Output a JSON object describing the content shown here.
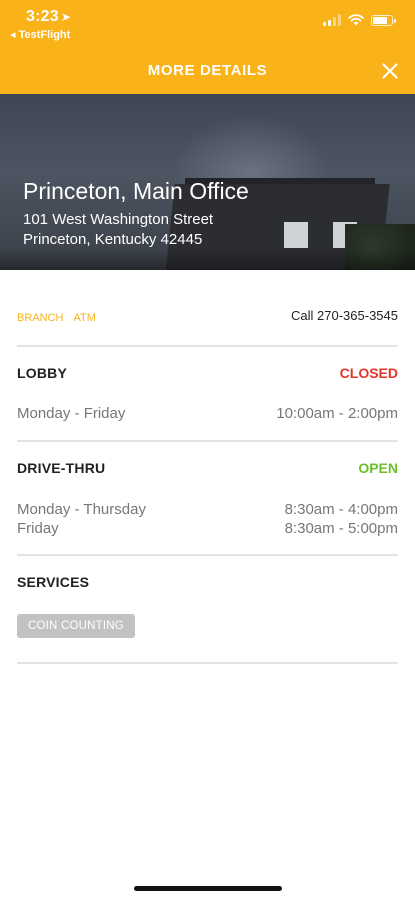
{
  "status_bar": {
    "time": "3:23",
    "location_arrow": "➤",
    "back_app": "◂ TestFlight",
    "icons": [
      "signal-icon",
      "wifi-icon",
      "battery-icon"
    ],
    "battery_level": 0.8
  },
  "header": {
    "title": "MORE DETAILS",
    "close_icon": "close-icon",
    "color": "#F9B218"
  },
  "location": {
    "name": "Princeton, Main Office",
    "address_line1": "101 West Washington Street",
    "address_line2": "Princeton, Kentucky 42445"
  },
  "tags": {
    "branch": "BRANCH",
    "atm": "ATM"
  },
  "call": {
    "label": "Call 270-365-3545"
  },
  "lobby": {
    "title": "LOBBY",
    "status": "CLOSED",
    "status_color": "#E2352B",
    "hours": [
      {
        "days": "Monday - Friday",
        "time": "10:00am - 2:00pm"
      }
    ]
  },
  "drive_thru": {
    "title": "DRIVE-THRU",
    "status": "OPEN",
    "status_color": "#6DBE2D",
    "hours": [
      {
        "days": "Monday - Thursday",
        "time": "8:30am - 4:00pm"
      },
      {
        "days": "Friday",
        "time": "8:30am - 5:00pm"
      }
    ]
  },
  "services": {
    "title": "SERVICES",
    "items": [
      "COIN COUNTING"
    ]
  }
}
